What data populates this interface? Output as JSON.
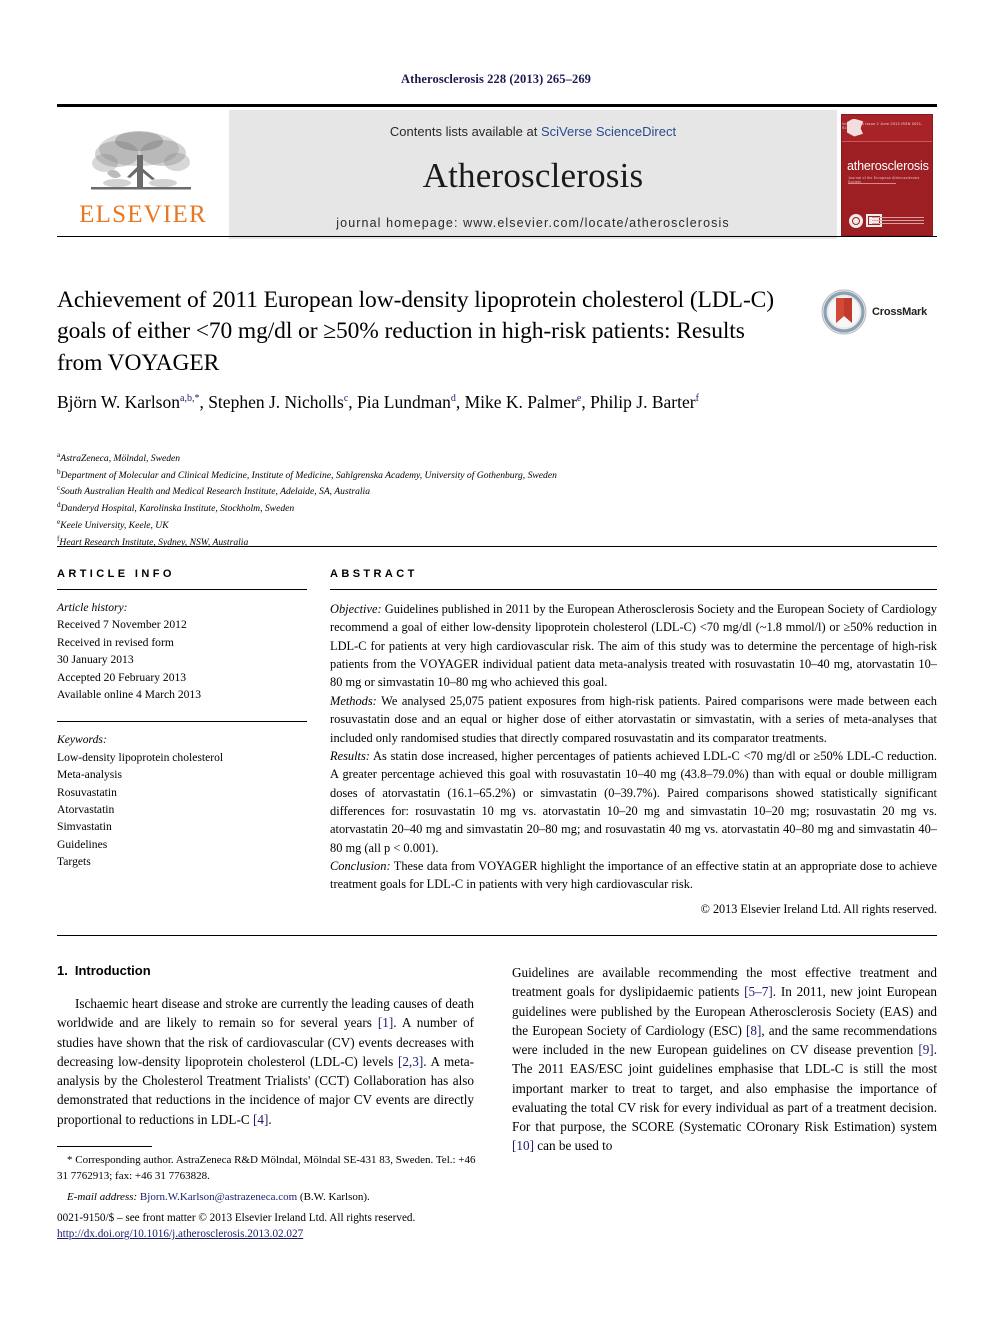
{
  "running_head": "Atherosclerosis 228 (2013) 265–269",
  "masthead": {
    "publisher_name": "ELSEVIER",
    "contents_prefix": "Contents lists available at ",
    "contents_link": "SciVerse ScienceDirect",
    "journal_name": "Atherosclerosis",
    "homepage": "journal homepage: www.elsevier.com/locate/atherosclerosis",
    "cover": {
      "title": "atherosclerosis",
      "subtitle": "Journal of the European Atherosclerosis Society",
      "top_text": "Volume 228  Issue 2  June 2013  ISSN 0021-9150"
    }
  },
  "crossmark": {
    "label": "CrossMark"
  },
  "title": "Achievement of 2011 European low-density lipoprotein cholesterol (LDL-C) goals of either <70 mg/dl or ≥50% reduction in high-risk patients: Results from VOYAGER",
  "authors": [
    {
      "name": "Björn W. Karlson",
      "marks": "a,b,*"
    },
    {
      "name": "Stephen J. Nicholls",
      "marks": "c"
    },
    {
      "name": "Pia Lundman",
      "marks": "d"
    },
    {
      "name": "Mike K. Palmer",
      "marks": "e"
    },
    {
      "name": "Philip J. Barter",
      "marks": "f"
    }
  ],
  "affiliations": [
    {
      "mark": "a",
      "text": "AstraZeneca, Mölndal, Sweden"
    },
    {
      "mark": "b",
      "text": "Department of Molecular and Clinical Medicine, Institute of Medicine, Sahlgrenska Academy, University of Gothenburg, Sweden"
    },
    {
      "mark": "c",
      "text": "South Australian Health and Medical Research Institute, Adelaide, SA, Australia"
    },
    {
      "mark": "d",
      "text": "Danderyd Hospital, Karolinska Institute, Stockholm, Sweden"
    },
    {
      "mark": "e",
      "text": "Keele University, Keele, UK"
    },
    {
      "mark": "f",
      "text": "Heart Research Institute, Sydney, NSW, Australia"
    }
  ],
  "article_info": {
    "heading": "ARTICLE INFO",
    "history_label": "Article history:",
    "history": [
      "Received 7 November 2012",
      "Received in revised form",
      "30 January 2013",
      "Accepted 20 February 2013",
      "Available online 4 March 2013"
    ],
    "keywords_label": "Keywords:",
    "keywords": [
      "Low-density lipoprotein cholesterol",
      "Meta-analysis",
      "Rosuvastatin",
      "Atorvastatin",
      "Simvastatin",
      "Guidelines",
      "Targets"
    ]
  },
  "abstract": {
    "heading": "ABSTRACT",
    "objective_label": "Objective:",
    "objective": " Guidelines published in 2011 by the European Atherosclerosis Society and the European Society of Cardiology recommend a goal of either low-density lipoprotein cholesterol (LDL-C) <70 mg/dl (~1.8 mmol/l) or ≥50% reduction in LDL-C for patients at very high cardiovascular risk. The aim of this study was to determine the percentage of high-risk patients from the VOYAGER individual patient data meta-analysis treated with rosuvastatin 10–40 mg, atorvastatin 10–80 mg or simvastatin 10–80 mg who achieved this goal.",
    "methods_label": "Methods:",
    "methods": " We analysed 25,075 patient exposures from high-risk patients. Paired comparisons were made between each rosuvastatin dose and an equal or higher dose of either atorvastatin or simvastatin, with a series of meta-analyses that included only randomised studies that directly compared rosuvastatin and its comparator treatments.",
    "results_label": "Results:",
    "results": " As statin dose increased, higher percentages of patients achieved LDL-C <70 mg/dl or ≥50% LDL-C reduction. A greater percentage achieved this goal with rosuvastatin 10–40 mg (43.8–79.0%) than with equal or double milligram doses of atorvastatin (16.1–65.2%) or simvastatin (0–39.7%). Paired comparisons showed statistically significant differences for: rosuvastatin 10 mg vs. atorvastatin 10–20 mg and simvastatin 10–20 mg; rosuvastatin 20 mg vs. atorvastatin 20–40 mg and simvastatin 20–80 mg; and rosuvastatin 40 mg vs. atorvastatin 40–80 mg and simvastatin 40–80 mg (all p < 0.001).",
    "conclusion_label": "Conclusion:",
    "conclusion": " These data from VOYAGER highlight the importance of an effective statin at an appropriate dose to achieve treatment goals for LDL-C in patients with very high cardiovascular risk.",
    "copyright": "© 2013 Elsevier Ireland Ltd. All rights reserved."
  },
  "introduction": {
    "number": "1.",
    "heading": "Introduction",
    "para1": "Ischaemic heart disease and stroke are currently the leading causes of death worldwide and are likely to remain so for several years [1]. A number of studies have shown that the risk of cardiovascular (CV) events decreases with decreasing low-density lipoprotein cholesterol (LDL-C) levels [2,3]. A meta-analysis by the Cholesterol Treatment Trialists' (CCT) Collaboration has also demonstrated that reductions in the incidence of major CV events are directly proportional to reductions in LDL-C [4].",
    "para2": "Guidelines are available recommending the most effective treatment and treatment goals for dyslipidaemic patients [5–7]. In 2011, new joint European guidelines were published by the European Atherosclerosis Society (EAS) and the European Society of Cardiology (ESC) [8], and the same recommendations were included in the new European guidelines on CV disease prevention [9]. The 2011 EAS/ESC joint guidelines emphasise that LDL-C is still the most important marker to treat to target, and also emphasise the importance of evaluating the total CV risk for every individual as part of a treatment decision. For that purpose, the SCORE (Systematic COronary Risk Estimation) system [10] can be used to"
  },
  "footnotes": {
    "corresponding": "* Corresponding author. AstraZeneca R&D Mölndal, Mölndal SE-431 83, Sweden. Tel.: +46 31 7762913; fax: +46 31 7763828.",
    "email_label": "E-mail address:",
    "email": "Bjorn.W.Karlson@astrazeneca.com",
    "email_suffix": " (B.W. Karlson)."
  },
  "frontmatter": {
    "line": "0021-9150/$ – see front matter © 2013 Elsevier Ireland Ltd. All rights reserved.",
    "doi": "http://dx.doi.org/10.1016/j.atherosclerosis.2013.02.027"
  }
}
